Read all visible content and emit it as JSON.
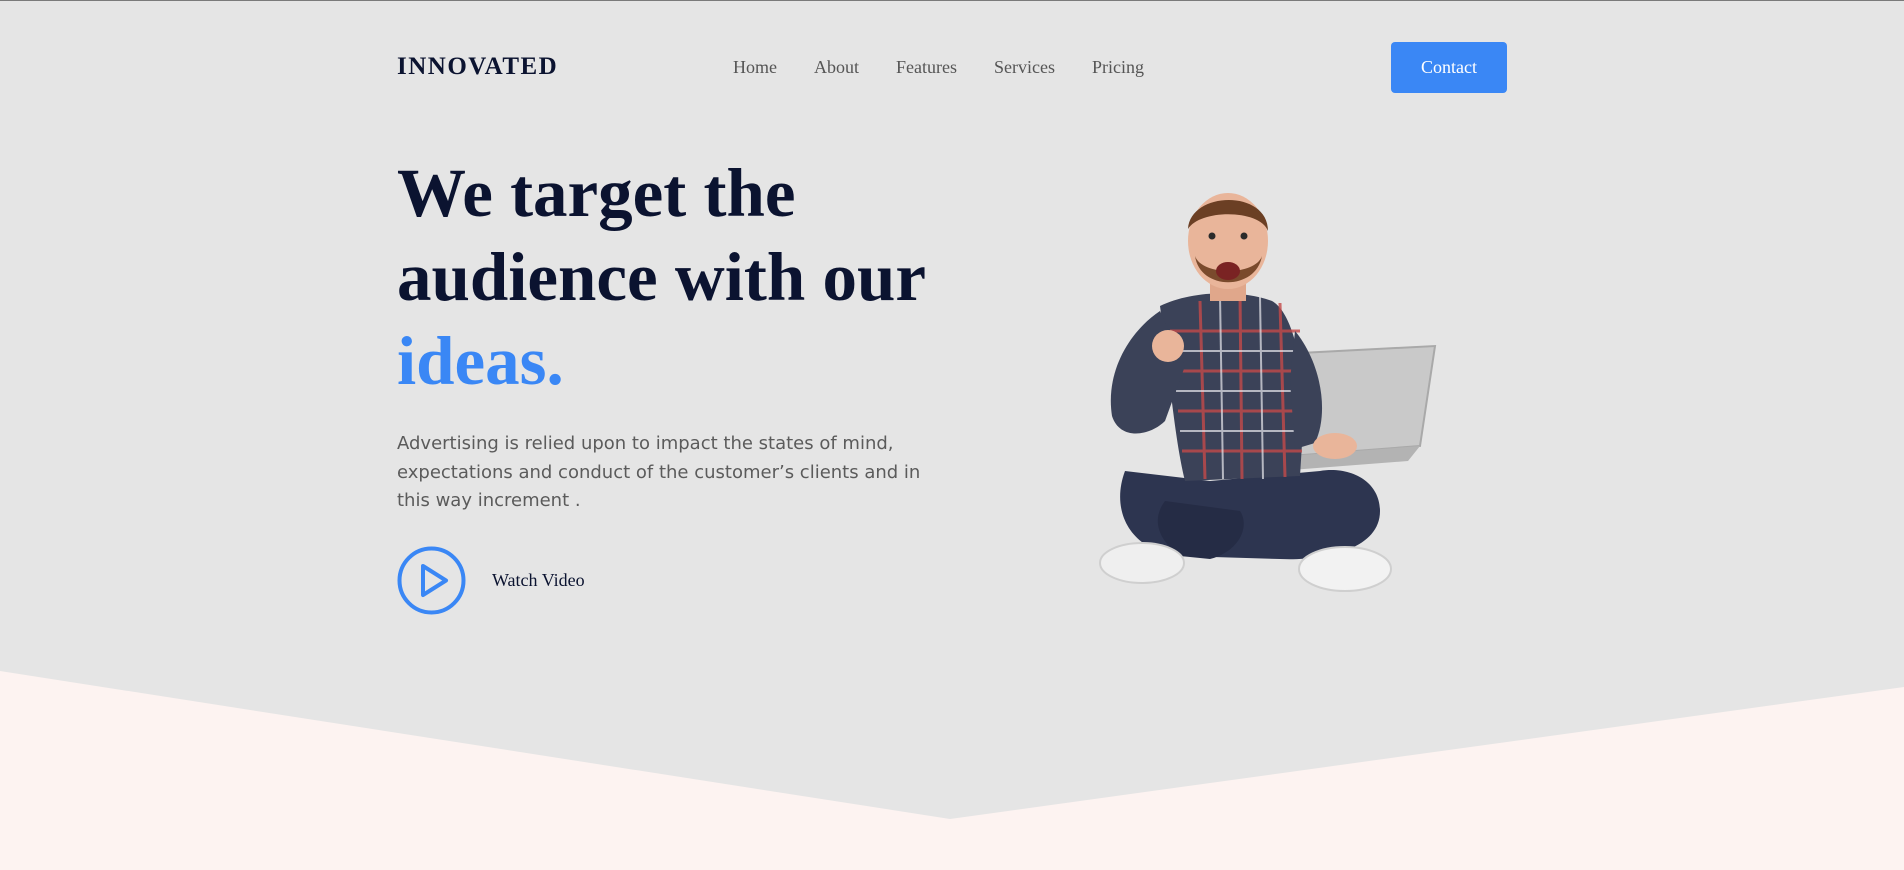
{
  "header": {
    "logo": "INNOVATED",
    "nav": [
      "Home",
      "About",
      "Features",
      "Services",
      "Pricing"
    ],
    "contact_label": "Contact"
  },
  "hero": {
    "title_line1": "We target the",
    "title_line2": "audience with our",
    "title_accent": "ideas.",
    "description": "Advertising is relied upon to impact the states of mind, expectations and conduct of the customer’s clients and in this way increment .",
    "watch_label": "Watch Video",
    "image_icon": "person-with-laptop-illustration"
  },
  "colors": {
    "background": "#e5e5e5",
    "accent": "#3a87f5",
    "heading": "#0b1330",
    "bottom_section": "#fdf3f1"
  }
}
